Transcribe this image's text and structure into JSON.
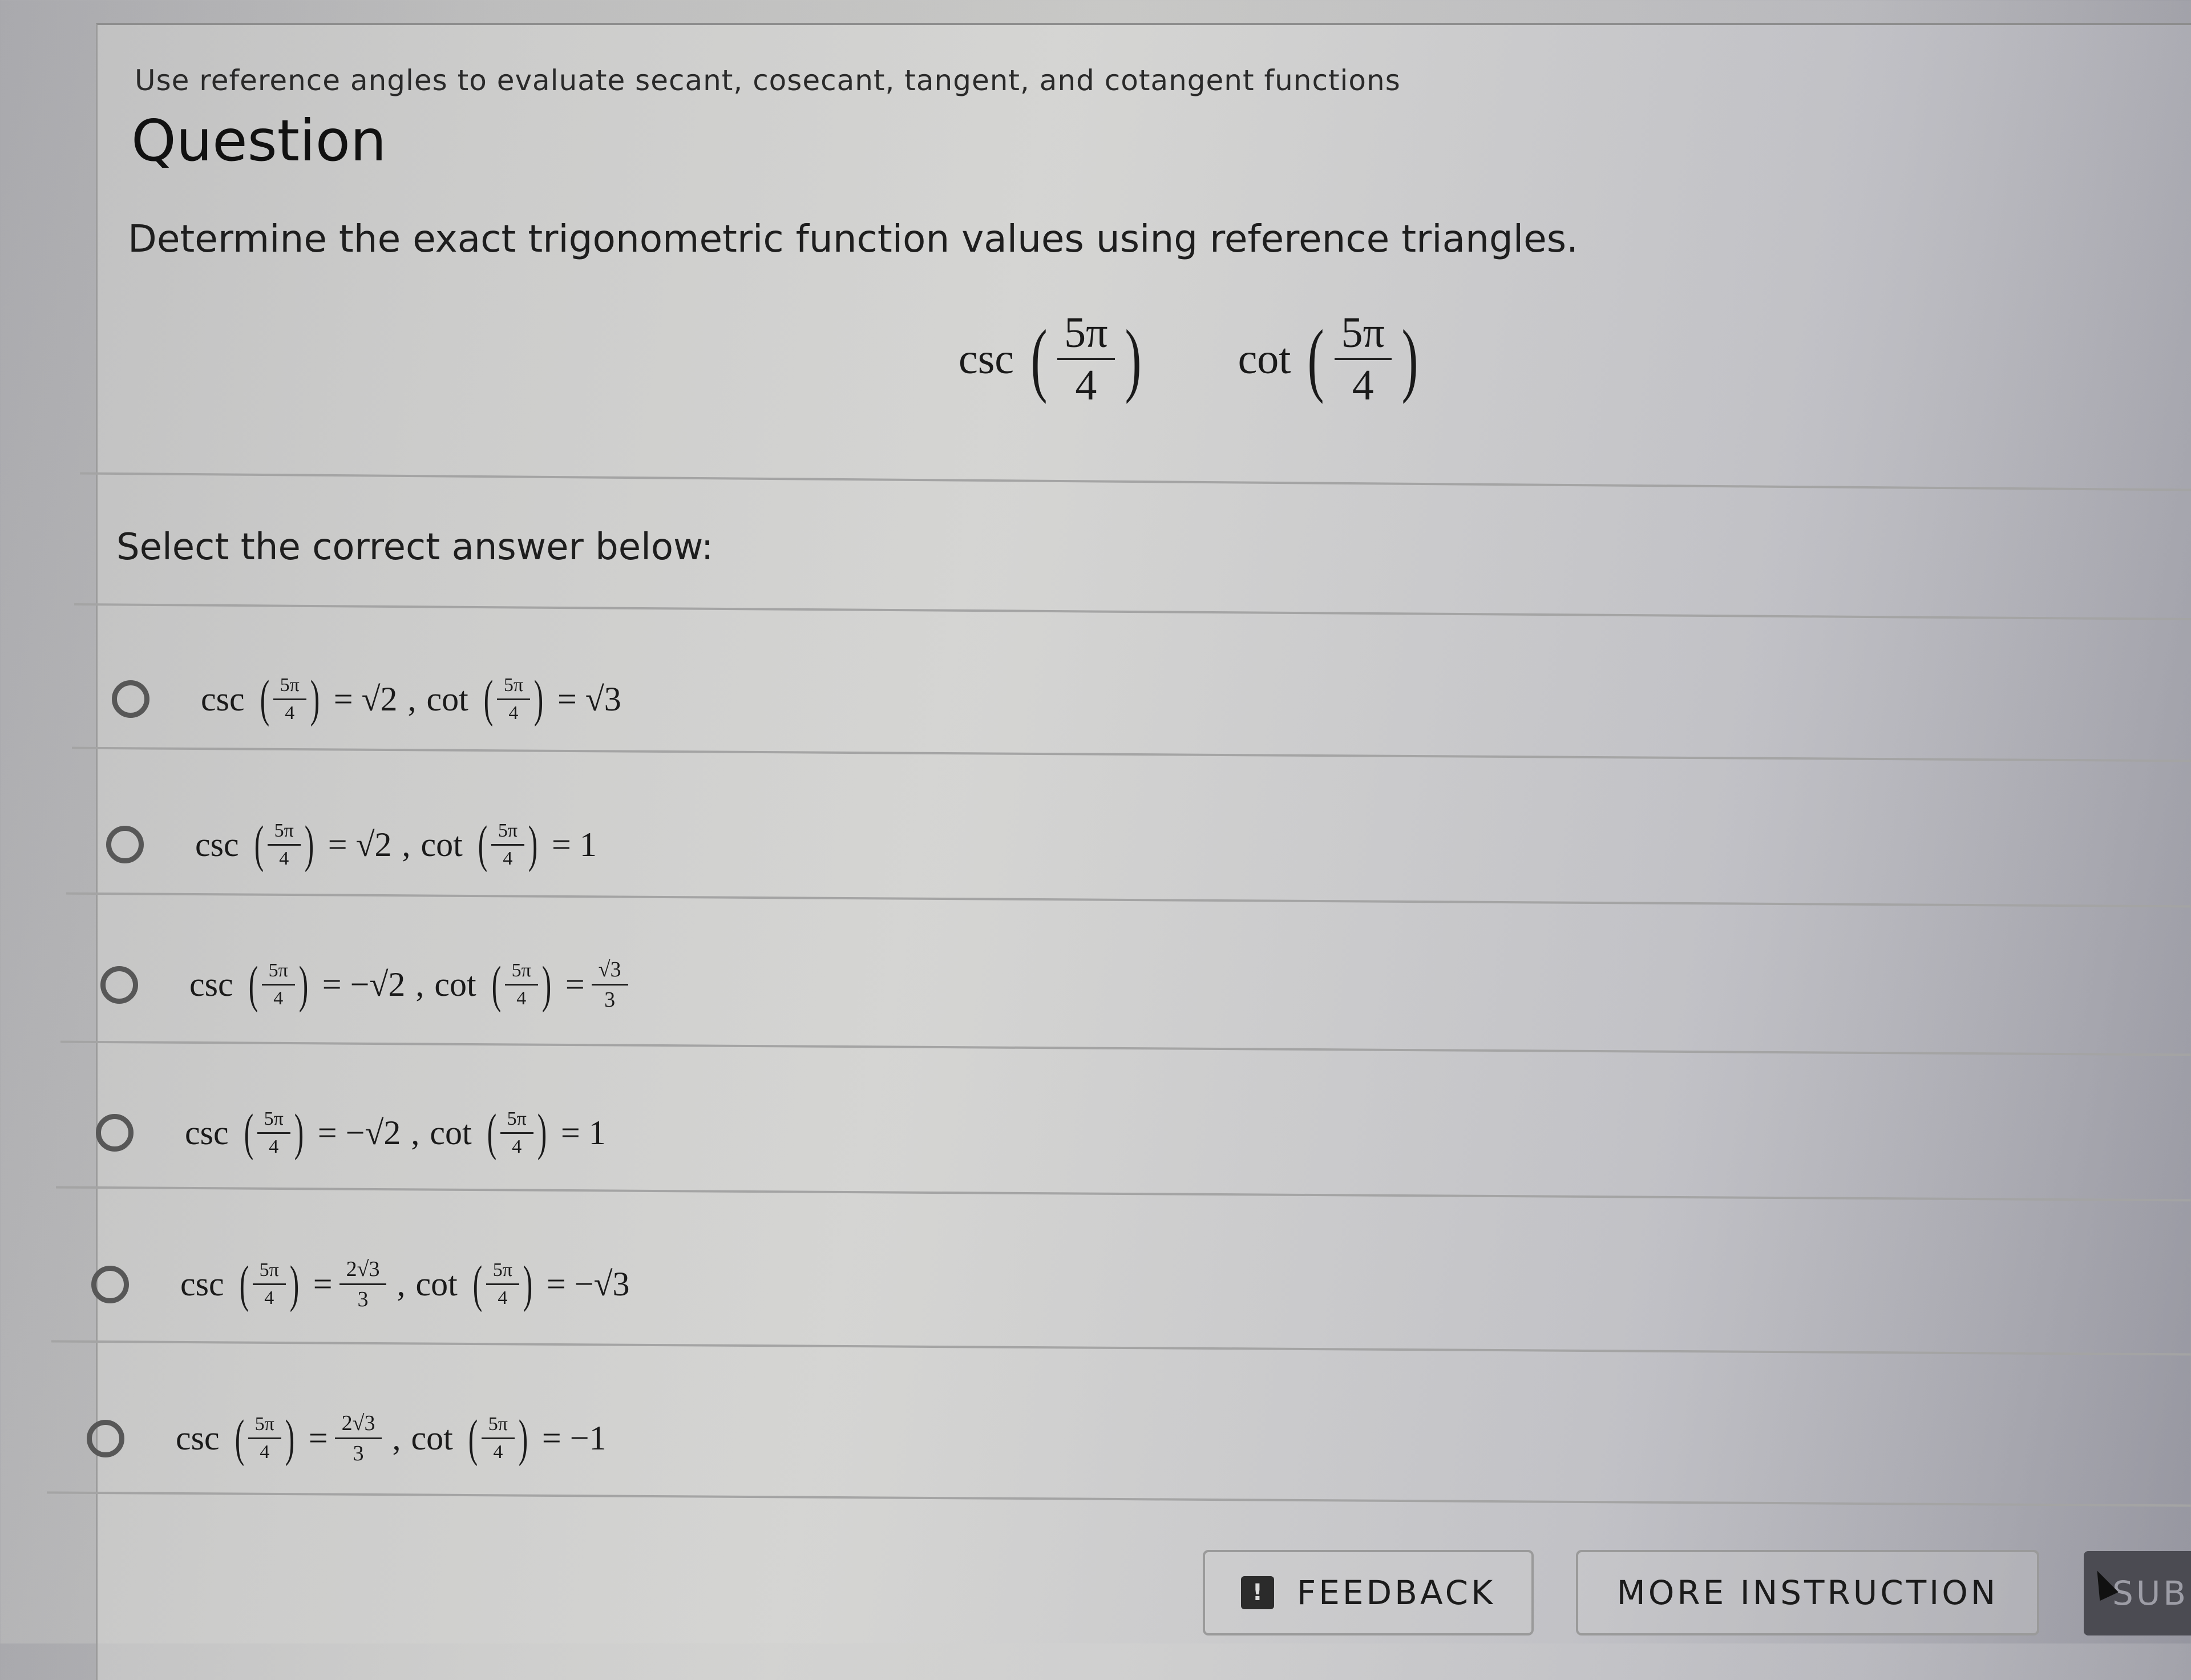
{
  "header": {
    "subtitle": "Use reference angles to evaluate secant, cosecant, tangent, and cotangent functions",
    "title": "Question"
  },
  "question": {
    "prompt": "Determine the exact trigonometric function values using reference triangles.",
    "expressions": [
      {
        "fn": "csc",
        "num": "5π",
        "den": "4"
      },
      {
        "fn": "cot",
        "num": "5π",
        "den": "4"
      }
    ]
  },
  "answer_section": {
    "label": "Select the correct answer below:",
    "options": [
      {
        "csc_value": "= √2",
        "cot_value": "= √3",
        "selected": false
      },
      {
        "csc_value": "= √2",
        "cot_value": "= 1",
        "selected": false
      },
      {
        "csc_value": "= −√2",
        "cot_value": "=",
        "cot_frac_num": "√3",
        "cot_frac_den": "3",
        "selected": false
      },
      {
        "csc_value": "= −√2",
        "cot_value": "= 1",
        "selected": false
      },
      {
        "csc_value": "=",
        "csc_frac_num": "2√3",
        "csc_frac_den": "3",
        "cot_value": "= −√3",
        "selected": false
      },
      {
        "csc_value": "=",
        "csc_frac_num": "2√3",
        "csc_frac_den": "3",
        "cot_value": "= −1",
        "selected": false
      }
    ],
    "arg_num": "5π",
    "arg_den": "4",
    "csc_label": "csc",
    "cot_label": "cot"
  },
  "footer": {
    "feedback_label": "FEEDBACK",
    "feedback_icon_glyph": "!",
    "more_instruction_label": "MORE INSTRUCTION",
    "submit_label": "SUB"
  }
}
